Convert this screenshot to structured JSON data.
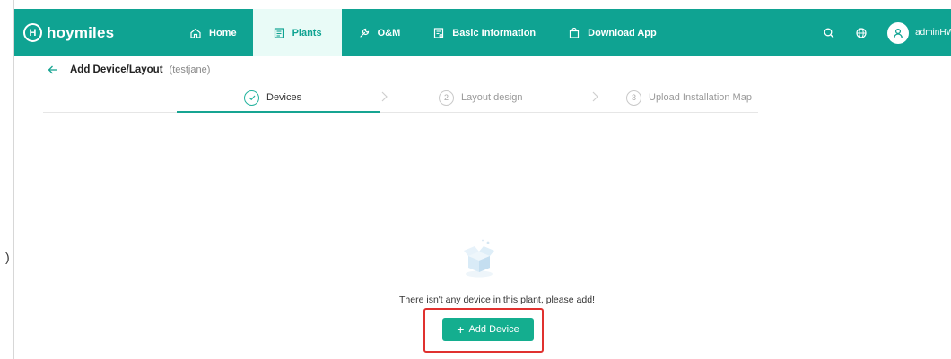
{
  "brand": {
    "logo_mark": "H",
    "name": "hoymiles",
    "color": "#0fa392"
  },
  "nav": {
    "items": [
      {
        "label": "Home",
        "icon": "home-icon"
      },
      {
        "label": "Plants",
        "icon": "document-icon",
        "active": true
      },
      {
        "label": "O&M",
        "icon": "wrench-icon"
      },
      {
        "label": "Basic Information",
        "icon": "info-sheet-icon"
      },
      {
        "label": "Download App",
        "icon": "bag-icon"
      }
    ]
  },
  "topbar": {
    "username": "adminHW",
    "icons": [
      "search-icon",
      "globe-icon",
      "user-icon"
    ]
  },
  "header": {
    "title": "Add Device/Layout",
    "subtitle": "(testjane)"
  },
  "steps": [
    {
      "index": "1",
      "label": "Devices",
      "status": "done"
    },
    {
      "index": "2",
      "label": "Layout design",
      "status": "pending"
    },
    {
      "index": "3",
      "label": "Upload Installation Map",
      "status": "pending"
    }
  ],
  "empty": {
    "message": "There isn't any device in this plant, please add!",
    "button_label": "Add Device"
  },
  "gutter_glyph": ")",
  "colors": {
    "accent": "#14ae8f",
    "highlight": "#e0312f"
  }
}
